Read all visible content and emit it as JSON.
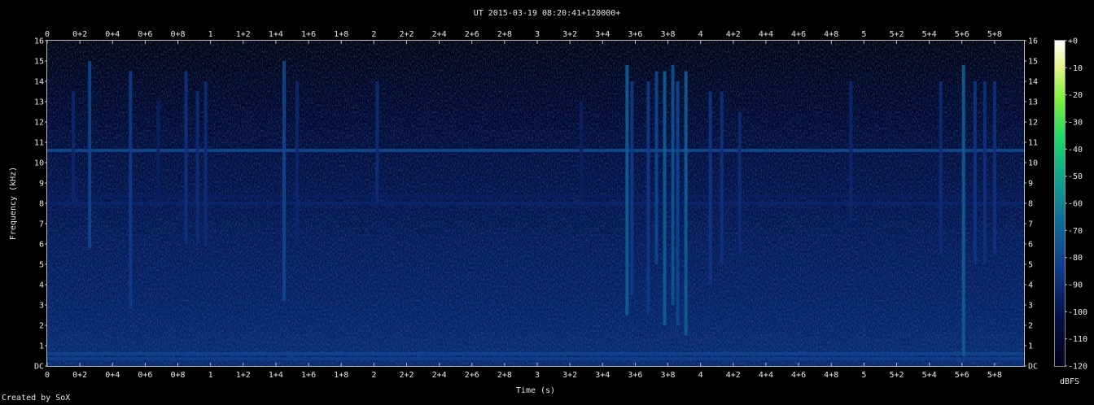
{
  "chart_data": {
    "type": "heatmap",
    "title": "UT 2015-03-19 08:20:41+120000+",
    "xlabel": "Time (s)",
    "ylabel": "Frequency (kHz)",
    "xlim": [
      0,
      5.98
    ],
    "ylim": [
      0,
      16
    ],
    "x_ticks": [
      "0",
      "0+2",
      "0+4",
      "0+6",
      "0+8",
      "1",
      "1+2",
      "1+4",
      "1+6",
      "1+8",
      "2",
      "2+2",
      "2+4",
      "2+6",
      "2+8",
      "3",
      "3+2",
      "3+4",
      "3+6",
      "3+8",
      "4",
      "4+2",
      "4+4",
      "4+6",
      "4+8",
      "5",
      "5+2",
      "5+4",
      "5+6",
      "5+8"
    ],
    "y_ticks": [
      "DC",
      "1",
      "2",
      "3",
      "4",
      "5",
      "6",
      "7",
      "8",
      "9",
      "10",
      "11",
      "12",
      "13",
      "14",
      "15",
      "16"
    ],
    "colorbar": {
      "label": "dBFS",
      "ticks": [
        "+0",
        "-10",
        "-20",
        "-30",
        "-40",
        "-50",
        "-60",
        "-70",
        "-80",
        "-90",
        "-100",
        "-110",
        "-120"
      ],
      "range": [
        -120,
        0
      ]
    },
    "grid": false,
    "horizontal_tones_khz": [
      {
        "freq": 10.6,
        "level_db": -78
      },
      {
        "freq": 8.35,
        "level_db": -95
      },
      {
        "freq": 8.0,
        "level_db": -93
      },
      {
        "freq": 0.6,
        "level_db": -80
      },
      {
        "freq": 0.35,
        "level_db": -83
      }
    ],
    "broadband_events": [
      {
        "t": 0.16,
        "f_low": 8.0,
        "f_high": 13.5,
        "level_db": -92
      },
      {
        "t": 0.26,
        "f_low": 5.8,
        "f_high": 15.0,
        "level_db": -80
      },
      {
        "t": 0.51,
        "f_low": 2.8,
        "f_high": 14.5,
        "level_db": -84
      },
      {
        "t": 0.68,
        "f_low": 8.0,
        "f_high": 13.0,
        "level_db": -95
      },
      {
        "t": 0.85,
        "f_low": 6.0,
        "f_high": 14.5,
        "level_db": -88
      },
      {
        "t": 0.92,
        "f_low": 6.0,
        "f_high": 13.5,
        "level_db": -90
      },
      {
        "t": 0.97,
        "f_low": 6.0,
        "f_high": 14.0,
        "level_db": -90
      },
      {
        "t": 1.45,
        "f_low": 3.2,
        "f_high": 15.0,
        "level_db": -80
      },
      {
        "t": 1.53,
        "f_low": 6.0,
        "f_high": 14.0,
        "level_db": -92
      },
      {
        "t": 2.02,
        "f_low": 8.0,
        "f_high": 14.0,
        "level_db": -90
      },
      {
        "t": 3.27,
        "f_low": 8.0,
        "f_high": 13.0,
        "level_db": -95
      },
      {
        "t": 3.55,
        "f_low": 2.5,
        "f_high": 14.8,
        "level_db": -72
      },
      {
        "t": 3.58,
        "f_low": 3.5,
        "f_high": 14.0,
        "level_db": -85
      },
      {
        "t": 3.68,
        "f_low": 2.5,
        "f_high": 14.0,
        "level_db": -85
      },
      {
        "t": 3.73,
        "f_low": 5.0,
        "f_high": 14.5,
        "level_db": -80
      },
      {
        "t": 3.78,
        "f_low": 2.0,
        "f_high": 14.5,
        "level_db": -72
      },
      {
        "t": 3.83,
        "f_low": 3.0,
        "f_high": 14.8,
        "level_db": -76
      },
      {
        "t": 3.86,
        "f_low": 2.0,
        "f_high": 14.0,
        "level_db": -80
      },
      {
        "t": 3.91,
        "f_low": 1.5,
        "f_high": 14.5,
        "level_db": -72
      },
      {
        "t": 4.06,
        "f_low": 4.0,
        "f_high": 13.5,
        "level_db": -86
      },
      {
        "t": 4.13,
        "f_low": 5.0,
        "f_high": 13.5,
        "level_db": -88
      },
      {
        "t": 4.24,
        "f_low": 5.5,
        "f_high": 12.5,
        "level_db": -90
      },
      {
        "t": 4.92,
        "f_low": 7.0,
        "f_high": 14.0,
        "level_db": -92
      },
      {
        "t": 5.47,
        "f_low": 5.5,
        "f_high": 14.0,
        "level_db": -90
      },
      {
        "t": 5.61,
        "f_low": 0.5,
        "f_high": 14.8,
        "level_db": -72
      },
      {
        "t": 5.68,
        "f_low": 5.0,
        "f_high": 14.0,
        "level_db": -86
      },
      {
        "t": 5.74,
        "f_low": 5.0,
        "f_high": 14.0,
        "level_db": -88
      },
      {
        "t": 5.8,
        "f_low": 5.5,
        "f_high": 14.0,
        "level_db": -88
      }
    ],
    "swept_tone": {
      "t_start": 2.05,
      "t_end": 2.2,
      "f_start": 7.0,
      "f_end": 5.0,
      "level_db": -94
    }
  },
  "footer": "Created by SoX"
}
